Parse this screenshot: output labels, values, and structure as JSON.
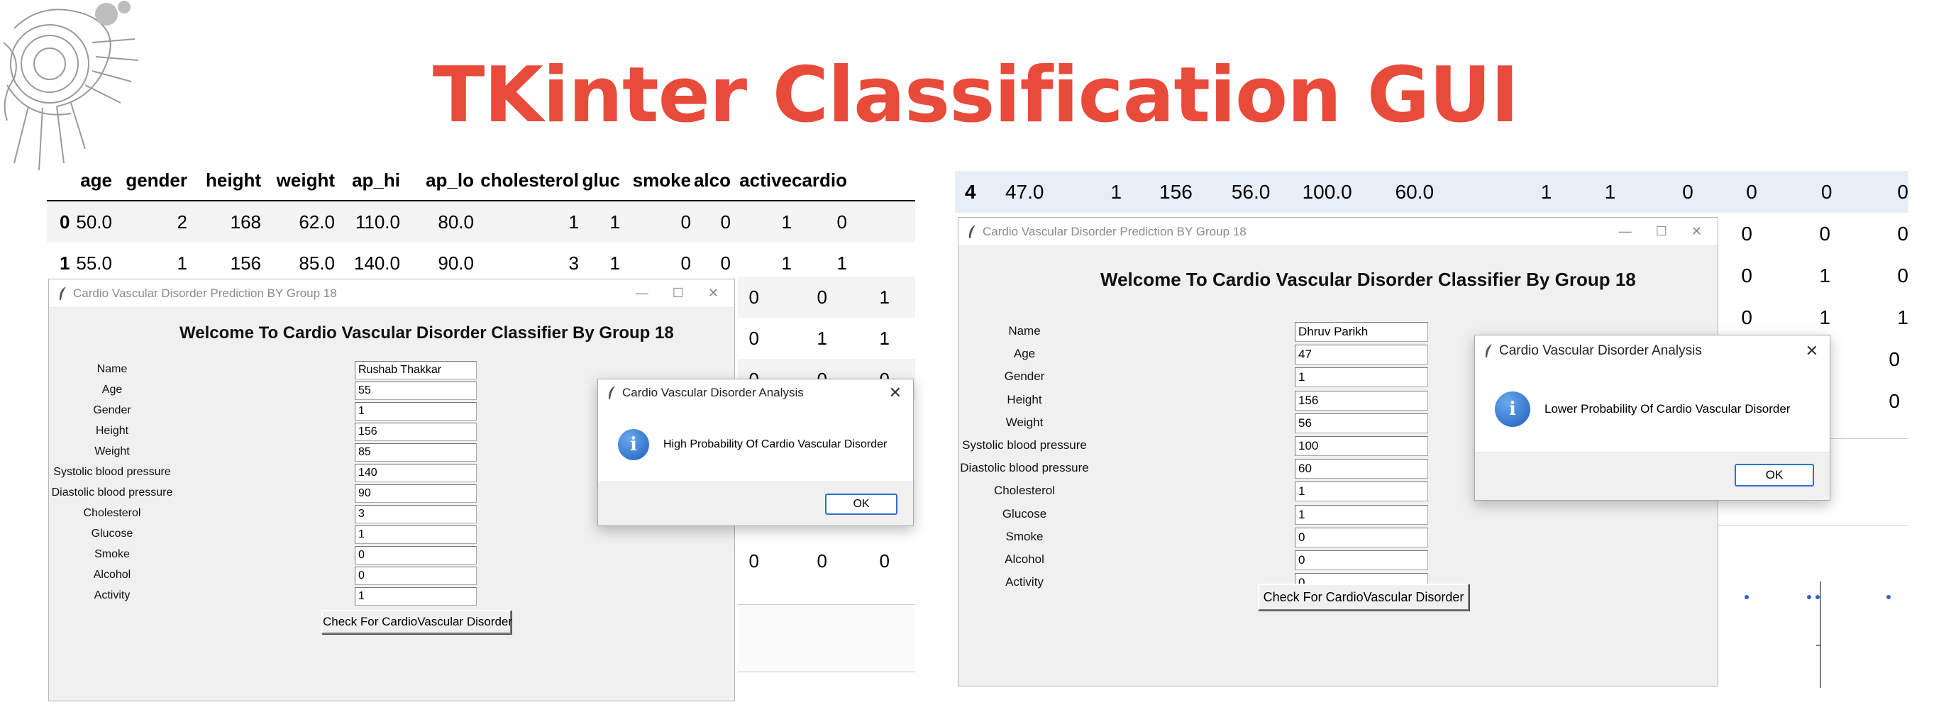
{
  "title": "TKinter Classification GUI",
  "colors": {
    "title": "#e84b3a",
    "info_icon": "#2f74d0"
  },
  "dataframe_left": {
    "columns": [
      "age",
      "gender",
      "height",
      "weight",
      "ap_hi",
      "ap_lo",
      "cholesterol",
      "gluc",
      "smoke",
      "alco",
      "active",
      "cardio"
    ],
    "rows": [
      {
        "index": "0",
        "cells": [
          "50.0",
          "2",
          "168",
          "62.0",
          "110.0",
          "80.0",
          "1",
          "1",
          "0",
          "0",
          "1",
          "0"
        ]
      },
      {
        "index": "1",
        "cells": [
          "55.0",
          "1",
          "156",
          "85.0",
          "140.0",
          "90.0",
          "3",
          "1",
          "0",
          "0",
          "1",
          "1"
        ]
      }
    ],
    "partial_rows": [
      [
        "0",
        "0",
        "1"
      ],
      [
        "0",
        "1",
        "1"
      ],
      [
        "0",
        "0",
        "0"
      ],
      [
        "0",
        "0",
        "0"
      ]
    ]
  },
  "dataframe_right": {
    "first_row": {
      "index": "4",
      "cells": [
        "47.0",
        "1",
        "156",
        "56.0",
        "100.0",
        "60.0",
        "1",
        "1",
        "0",
        "0",
        "0",
        "0"
      ]
    },
    "partial_rows": [
      [
        "0",
        "0",
        "0"
      ],
      [
        "0",
        "1",
        "0"
      ],
      [
        "0",
        "1",
        "1"
      ],
      [
        "0"
      ],
      [
        "0"
      ]
    ]
  },
  "window_left": {
    "title": "Cardio Vascular Disorder Prediction BY Group 18",
    "controls": [
      "—",
      "☐",
      "✕"
    ],
    "welcome": "Welcome To Cardio Vascular Disorder Classifier By Group 18",
    "fields": [
      {
        "label": "Name",
        "value": "Rushab Thakkar"
      },
      {
        "label": "Age",
        "value": "55"
      },
      {
        "label": "Gender",
        "value": "1"
      },
      {
        "label": "Height",
        "value": "156"
      },
      {
        "label": "Weight",
        "value": "85"
      },
      {
        "label": "Systolic blood pressure",
        "value": "140"
      },
      {
        "label": "Diastolic blood pressure",
        "value": "90"
      },
      {
        "label": "Cholesterol",
        "value": "3"
      },
      {
        "label": "Glucose",
        "value": "1"
      },
      {
        "label": "Smoke",
        "value": "0"
      },
      {
        "label": "Alcohol",
        "value": "0"
      },
      {
        "label": "Activity",
        "value": "1"
      }
    ],
    "button": "Check For CardioVascular Disorder"
  },
  "dialog_left": {
    "title": "Cardio Vascular Disorder Analysis",
    "icon": "info-icon",
    "message": "High Probability Of Cardio Vascular Disorder",
    "ok": "OK"
  },
  "window_right": {
    "title": "Cardio Vascular Disorder Prediction BY Group 18",
    "controls": [
      "—",
      "☐",
      "✕"
    ],
    "welcome": "Welcome To Cardio Vascular Disorder Classifier By Group 18",
    "fields": [
      {
        "label": "Name",
        "value": "Dhruv Parikh"
      },
      {
        "label": "Age",
        "value": "47"
      },
      {
        "label": "Gender",
        "value": "1"
      },
      {
        "label": "Height",
        "value": "156"
      },
      {
        "label": "Weight",
        "value": "56"
      },
      {
        "label": "Systolic blood pressure",
        "value": "100"
      },
      {
        "label": "Diastolic blood pressure",
        "value": "60"
      },
      {
        "label": "Cholesterol",
        "value": "1"
      },
      {
        "label": "Glucose",
        "value": "1"
      },
      {
        "label": "Smoke",
        "value": "0"
      },
      {
        "label": "Alcohol",
        "value": "0"
      },
      {
        "label": "Activity",
        "value": "0"
      }
    ],
    "button": "Check For CardioVascular Disorder"
  },
  "dialog_right": {
    "title": "Cardio Vascular Disorder Analysis",
    "icon": "info-icon",
    "message": "Lower Probability Of Cardio Vascular Disorder",
    "ok": "OK"
  }
}
